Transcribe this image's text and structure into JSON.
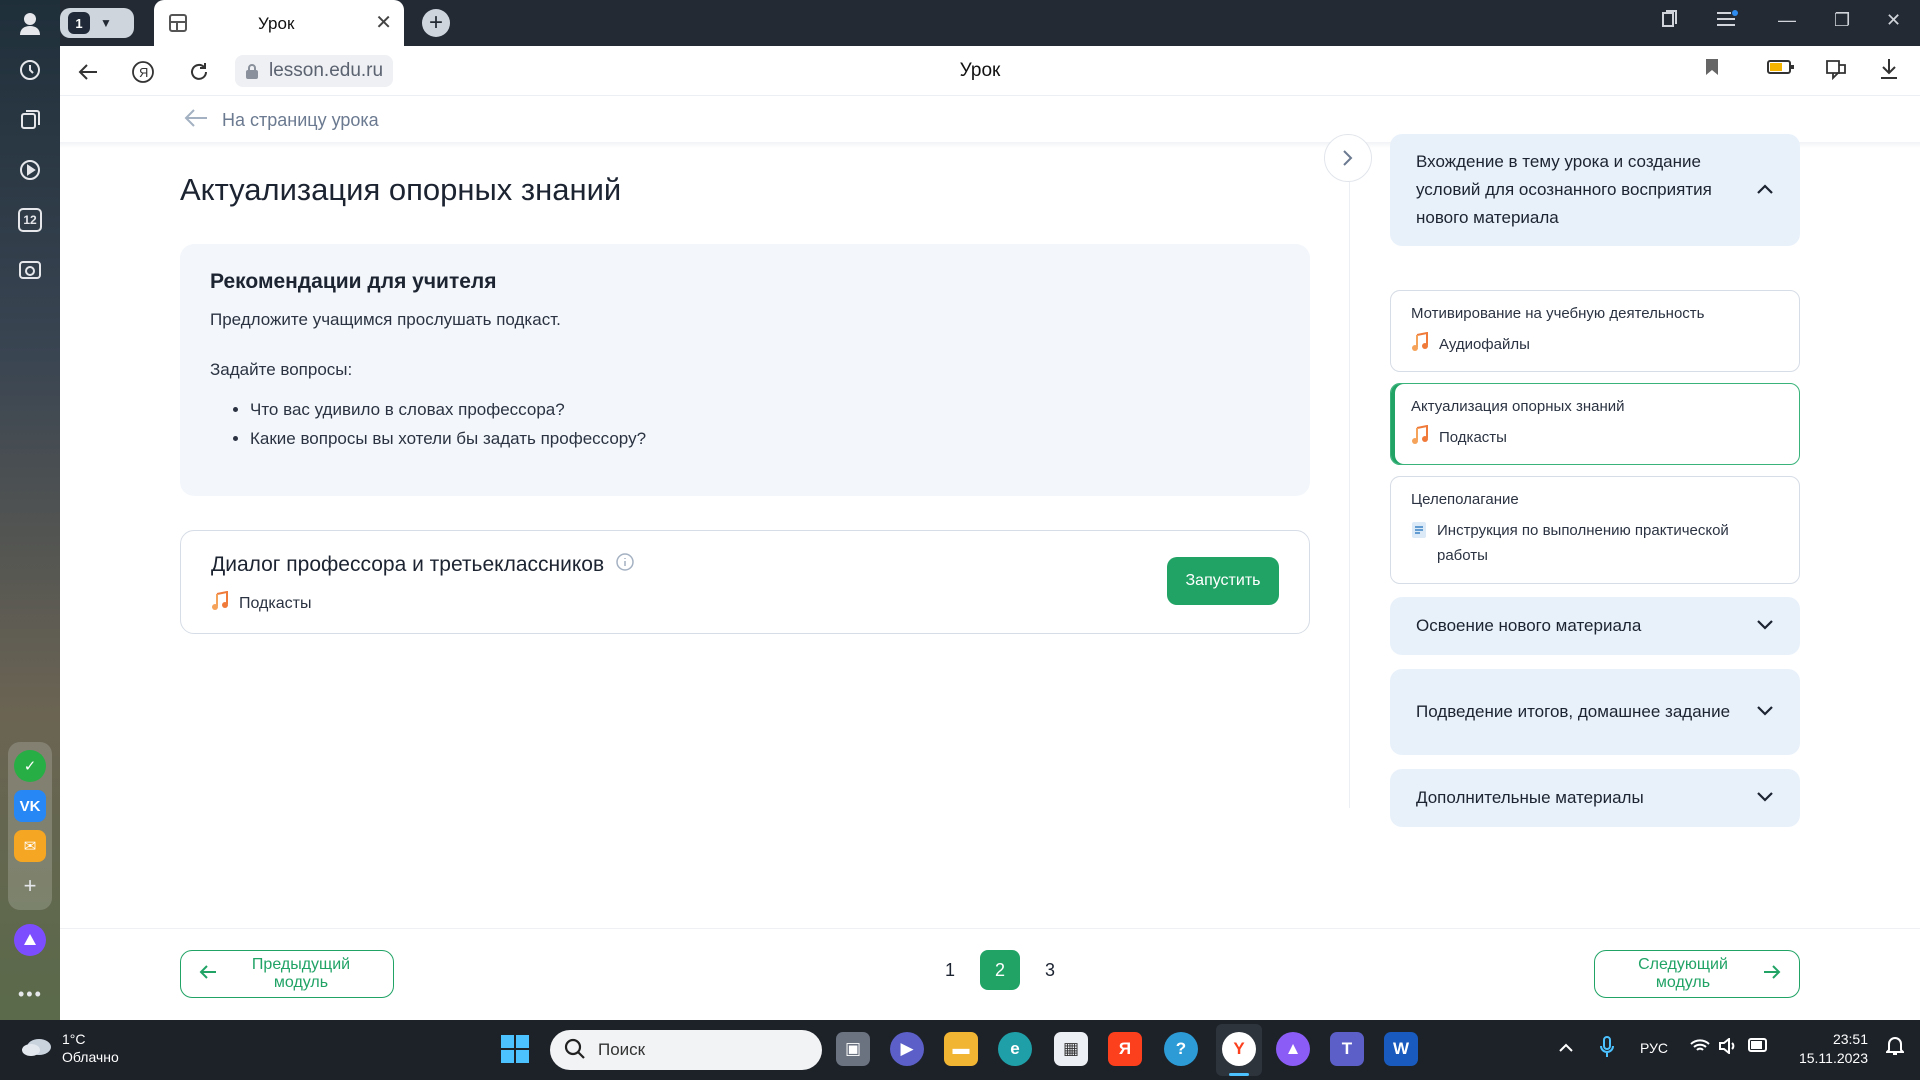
{
  "browser": {
    "tab_count": "1",
    "active_tab_title": "Урок",
    "url": "lesson.edu.ru",
    "page_title": "Урок"
  },
  "sidebar": {
    "history_badge": "12"
  },
  "content": {
    "back_link": "На страницу урока",
    "title": "Актуализация опорных знаний",
    "recommendations": {
      "heading": "Рекомендации для учителя",
      "intro": "Предложите учащимся прослушать подкаст.",
      "questions_label": "Задайте вопросы:",
      "questions": [
        "Что вас удивило в словах профессора?",
        "Какие вопросы вы хотели бы задать профессору?"
      ]
    },
    "activity": {
      "title": "Диалог профессора и третьеклассников",
      "type": "Подкасты",
      "run_label": "Запустить"
    }
  },
  "lesson_plan": {
    "section_1": "Вхождение в тему урока и создание условий для осознанного восприятия нового материала",
    "items": [
      {
        "title": "Мотивирование на учебную деятельность",
        "type": "Аудиофайлы",
        "icon": "music-icon"
      },
      {
        "title": "Актуализация опорных знаний",
        "type": "Подкасты",
        "icon": "music-icon"
      },
      {
        "title": "Целеполагание",
        "type": "Инструкция по выполнению практической работы",
        "icon": "document-icon"
      }
    ],
    "section_2": "Освоение нового материала",
    "section_3": "Подведение итогов, домашнее задание",
    "section_4": "Дополнительные материалы"
  },
  "pagination": {
    "prev_label": "Предыдущий модуль",
    "next_label": "Следующий модуль",
    "pages": [
      "1",
      "2",
      "3"
    ],
    "current": "2"
  },
  "taskbar": {
    "temperature": "1°C",
    "weather": "Облачно",
    "search_placeholder": "Поиск",
    "language": "РУС",
    "time": "23:51",
    "date": "15.11.2023"
  },
  "colors": {
    "accent": "#21a366",
    "panel": "#e8f1fa",
    "card": "#f3f7fb"
  }
}
